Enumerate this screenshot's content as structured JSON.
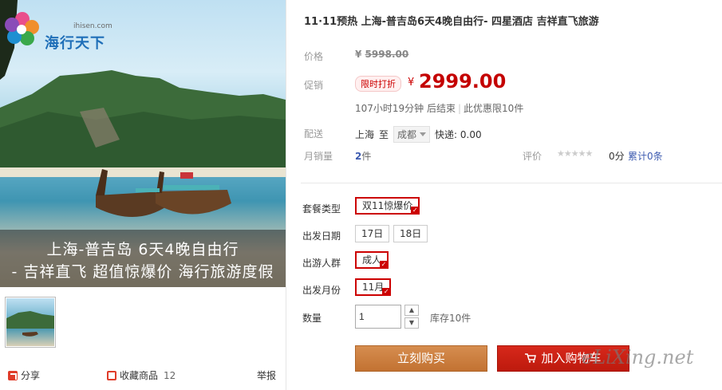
{
  "gallery": {
    "logo_url": "ihisen.com",
    "logo_text": "海行天下",
    "caption_line1": "上海-普吉岛 6天4晚自由行",
    "caption_line2": "- 吉祥直飞 超值惊爆价 海行旅游度假",
    "share_label": "分享",
    "favorite_label": "收藏商品",
    "favorite_count": "12",
    "report_label": "举报"
  },
  "product": {
    "title": "11·11预热 上海-普吉岛6天4晚自由行- 四星酒店 吉祥直飞旅游",
    "price_label": "价格",
    "original_price_currency": "¥",
    "original_price": "5998.00",
    "promo_label": "促销",
    "promo_badge": "限时打折",
    "promo_currency": "¥",
    "promo_price": "2999.00",
    "countdown": "107小时19分钟 后结束",
    "limit_text": "此优惠限10件",
    "ship_label": "配送",
    "ship_from": "上海",
    "ship_to_word": "至",
    "ship_to_city": "成都",
    "ship_fee": "快递: 0.00",
    "monthly_sales_label": "月销量",
    "monthly_sales_value": "2",
    "monthly_sales_unit": "件",
    "rating_label": "评价",
    "rating_stars": "★★★★★",
    "rating_score": "0分",
    "reviews": "累计0条"
  },
  "options": {
    "package_label": "套餐类型",
    "package_value": "双11惊爆价",
    "date_label": "出发日期",
    "dates": [
      "17日",
      "18日"
    ],
    "group_label": "出游人群",
    "group_value": "成人",
    "month_label": "出发月份",
    "month_value": "11月",
    "qty_label": "数量",
    "qty_value": "1",
    "stock": "库存10件"
  },
  "actions": {
    "buy_now": "立刻购买",
    "add_cart": "加入购物车"
  },
  "watermark": "eLiXing.net",
  "colors": {
    "price_red": "#c40000",
    "buy_now_bg": "#c87838",
    "add_cart_bg": "#c91f10",
    "select_border": "#cc0000",
    "link_blue": "#3d5bb0"
  }
}
